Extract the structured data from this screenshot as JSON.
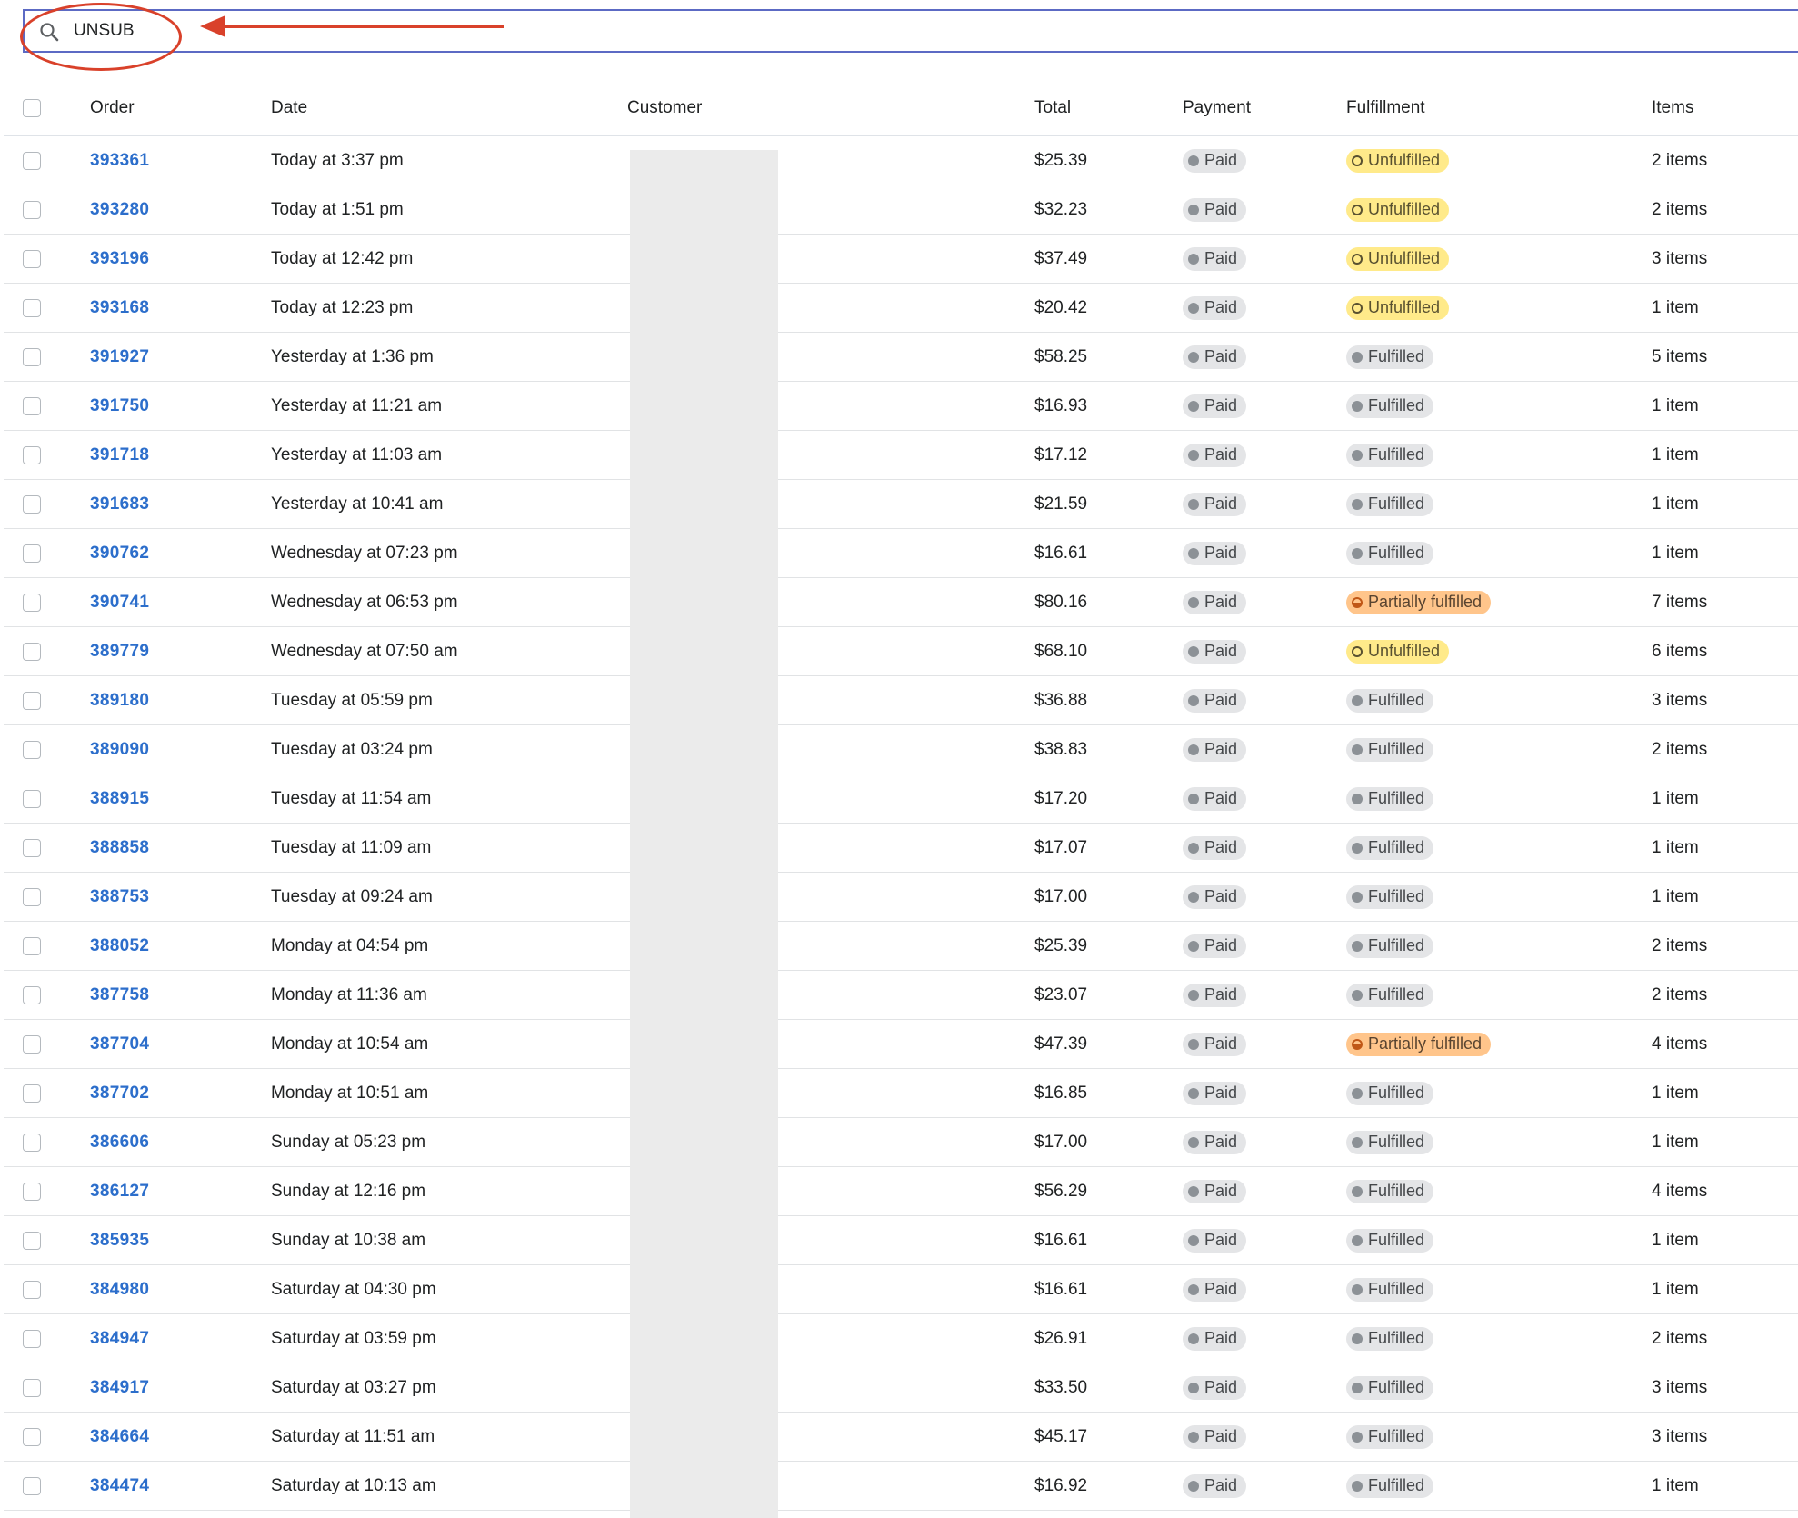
{
  "search": {
    "value": "UNSUB",
    "icon": "search-icon"
  },
  "colors": {
    "accent": "#2c6ecb",
    "annotation": "#d9412a",
    "unfulfilled": "#ffea8a",
    "partial": "#ffc58b",
    "neutral_badge": "#e4e5e7"
  },
  "table": {
    "headers": {
      "order": "Order",
      "date": "Date",
      "customer": "Customer",
      "total": "Total",
      "payment": "Payment",
      "fulfillment": "Fulfillment",
      "items": "Items"
    },
    "rows": [
      {
        "order": "393361",
        "date": "Today at 3:37 pm",
        "total": "$25.39",
        "payment": "Paid",
        "fulfillment": "Unfulfilled",
        "status": "unfulfilled",
        "items": "2 items"
      },
      {
        "order": "393280",
        "date": "Today at 1:51 pm",
        "total": "$32.23",
        "payment": "Paid",
        "fulfillment": "Unfulfilled",
        "status": "unfulfilled",
        "items": "2 items"
      },
      {
        "order": "393196",
        "date": "Today at 12:42 pm",
        "total": "$37.49",
        "payment": "Paid",
        "fulfillment": "Unfulfilled",
        "status": "unfulfilled",
        "items": "3 items"
      },
      {
        "order": "393168",
        "date": "Today at 12:23 pm",
        "total": "$20.42",
        "payment": "Paid",
        "fulfillment": "Unfulfilled",
        "status": "unfulfilled",
        "items": "1 item"
      },
      {
        "order": "391927",
        "date": "Yesterday at 1:36 pm",
        "total": "$58.25",
        "payment": "Paid",
        "fulfillment": "Fulfilled",
        "status": "fulfilled",
        "items": "5 items"
      },
      {
        "order": "391750",
        "date": "Yesterday at 11:21 am",
        "total": "$16.93",
        "payment": "Paid",
        "fulfillment": "Fulfilled",
        "status": "fulfilled",
        "items": "1 item"
      },
      {
        "order": "391718",
        "date": "Yesterday at 11:03 am",
        "total": "$17.12",
        "payment": "Paid",
        "fulfillment": "Fulfilled",
        "status": "fulfilled",
        "items": "1 item"
      },
      {
        "order": "391683",
        "date": "Yesterday at 10:41 am",
        "total": "$21.59",
        "payment": "Paid",
        "fulfillment": "Fulfilled",
        "status": "fulfilled",
        "items": "1 item"
      },
      {
        "order": "390762",
        "date": "Wednesday at 07:23 pm",
        "total": "$16.61",
        "payment": "Paid",
        "fulfillment": "Fulfilled",
        "status": "fulfilled",
        "items": "1 item"
      },
      {
        "order": "390741",
        "date": "Wednesday at 06:53 pm",
        "total": "$80.16",
        "payment": "Paid",
        "fulfillment": "Partially fulfilled",
        "status": "partial",
        "items": "7 items"
      },
      {
        "order": "389779",
        "date": "Wednesday at 07:50 am",
        "total": "$68.10",
        "payment": "Paid",
        "fulfillment": "Unfulfilled",
        "status": "unfulfilled",
        "items": "6 items"
      },
      {
        "order": "389180",
        "date": "Tuesday at 05:59 pm",
        "total": "$36.88",
        "payment": "Paid",
        "fulfillment": "Fulfilled",
        "status": "fulfilled",
        "items": "3 items"
      },
      {
        "order": "389090",
        "date": "Tuesday at 03:24 pm",
        "total": "$38.83",
        "payment": "Paid",
        "fulfillment": "Fulfilled",
        "status": "fulfilled",
        "items": "2 items"
      },
      {
        "order": "388915",
        "date": "Tuesday at 11:54 am",
        "total": "$17.20",
        "payment": "Paid",
        "fulfillment": "Fulfilled",
        "status": "fulfilled",
        "items": "1 item"
      },
      {
        "order": "388858",
        "date": "Tuesday at 11:09 am",
        "total": "$17.07",
        "payment": "Paid",
        "fulfillment": "Fulfilled",
        "status": "fulfilled",
        "items": "1 item"
      },
      {
        "order": "388753",
        "date": "Tuesday at 09:24 am",
        "total": "$17.00",
        "payment": "Paid",
        "fulfillment": "Fulfilled",
        "status": "fulfilled",
        "items": "1 item"
      },
      {
        "order": "388052",
        "date": "Monday at 04:54 pm",
        "total": "$25.39",
        "payment": "Paid",
        "fulfillment": "Fulfilled",
        "status": "fulfilled",
        "items": "2 items"
      },
      {
        "order": "387758",
        "date": "Monday at 11:36 am",
        "total": "$23.07",
        "payment": "Paid",
        "fulfillment": "Fulfilled",
        "status": "fulfilled",
        "items": "2 items"
      },
      {
        "order": "387704",
        "date": "Monday at 10:54 am",
        "total": "$47.39",
        "payment": "Paid",
        "fulfillment": "Partially fulfilled",
        "status": "partial",
        "items": "4 items"
      },
      {
        "order": "387702",
        "date": "Monday at 10:51 am",
        "total": "$16.85",
        "payment": "Paid",
        "fulfillment": "Fulfilled",
        "status": "fulfilled",
        "items": "1 item"
      },
      {
        "order": "386606",
        "date": "Sunday at 05:23 pm",
        "total": "$17.00",
        "payment": "Paid",
        "fulfillment": "Fulfilled",
        "status": "fulfilled",
        "items": "1 item"
      },
      {
        "order": "386127",
        "date": "Sunday at 12:16 pm",
        "total": "$56.29",
        "payment": "Paid",
        "fulfillment": "Fulfilled",
        "status": "fulfilled",
        "items": "4 items"
      },
      {
        "order": "385935",
        "date": "Sunday at 10:38 am",
        "total": "$16.61",
        "payment": "Paid",
        "fulfillment": "Fulfilled",
        "status": "fulfilled",
        "items": "1 item"
      },
      {
        "order": "384980",
        "date": "Saturday at 04:30 pm",
        "total": "$16.61",
        "payment": "Paid",
        "fulfillment": "Fulfilled",
        "status": "fulfilled",
        "items": "1 item"
      },
      {
        "order": "384947",
        "date": "Saturday at 03:59 pm",
        "total": "$26.91",
        "payment": "Paid",
        "fulfillment": "Fulfilled",
        "status": "fulfilled",
        "items": "2 items"
      },
      {
        "order": "384917",
        "date": "Saturday at 03:27 pm",
        "total": "$33.50",
        "payment": "Paid",
        "fulfillment": "Fulfilled",
        "status": "fulfilled",
        "items": "3 items"
      },
      {
        "order": "384664",
        "date": "Saturday at 11:51 am",
        "total": "$45.17",
        "payment": "Paid",
        "fulfillment": "Fulfilled",
        "status": "fulfilled",
        "items": "3 items"
      },
      {
        "order": "384474",
        "date": "Saturday at 10:13 am",
        "total": "$16.92",
        "payment": "Paid",
        "fulfillment": "Fulfilled",
        "status": "fulfilled",
        "items": "1 item"
      }
    ]
  }
}
